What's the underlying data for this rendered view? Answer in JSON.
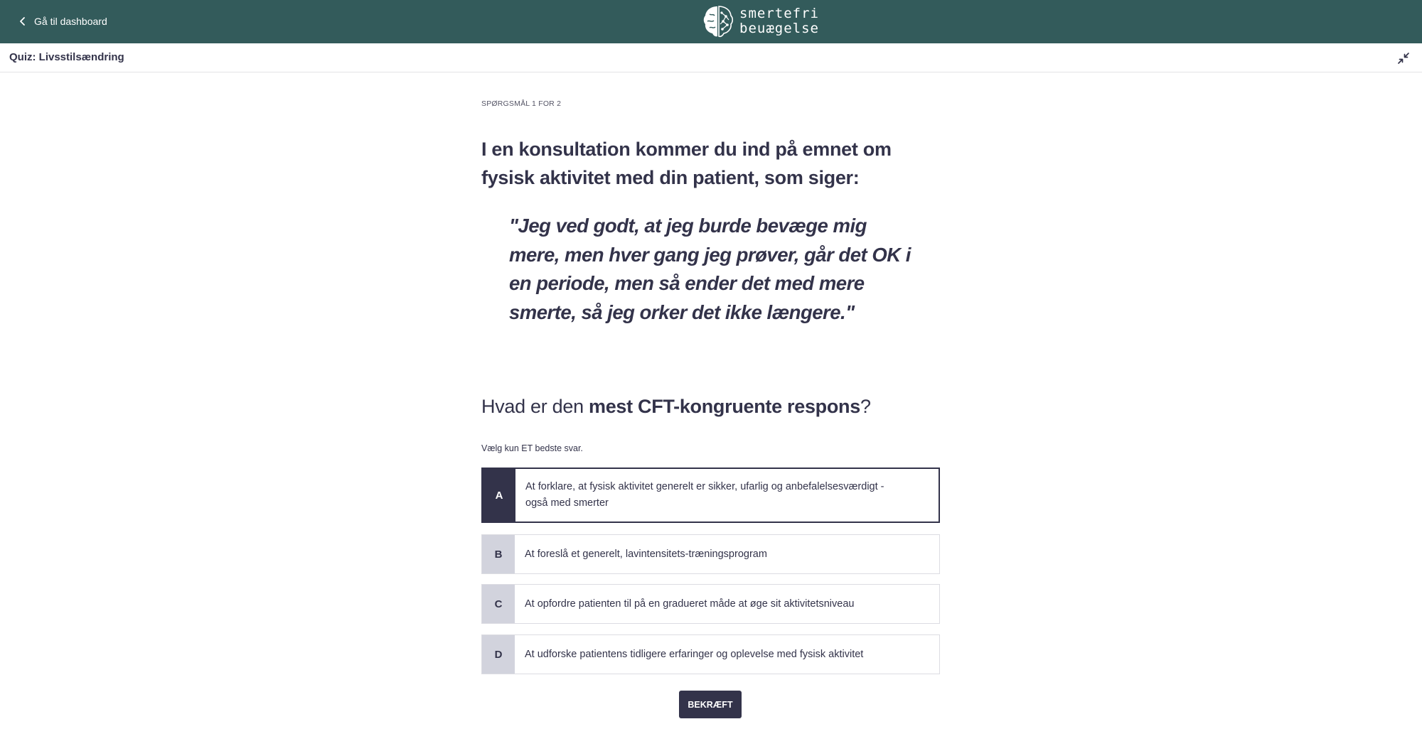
{
  "header": {
    "back_label": "Gå til dashboard",
    "logo_line1": "smertefri",
    "logo_line2": "beuægelse"
  },
  "subheader": {
    "title": "Quiz: Livsstilsændring"
  },
  "quiz": {
    "progress": "SPØRGSMÅL 1 FOR 2",
    "question": "I en konsultation kommer du ind på emnet om fysisk aktivitet med din patient, som siger:",
    "quote": "\"Jeg ved godt, at jeg burde bevæge mig mere, men hver gang jeg prøver, går det OK i en periode, men så ender det med mere smerte, så jeg orker det ikke længere.\"",
    "prompt_prefix": "Hvad er den ",
    "prompt_bold": "mest CFT-kongruente respons",
    "prompt_suffix": "?",
    "instruction": "Vælg kun ET bedste svar.",
    "options": [
      {
        "letter": "A",
        "text": "At forklare, at fysisk aktivitet generelt er sikker, ufarlig og anbefalelsesværdigt - også med smerter",
        "selected": true
      },
      {
        "letter": "B",
        "text": "At foreslå et generelt, lavintensitets-træningsprogram",
        "selected": false
      },
      {
        "letter": "C",
        "text": "At opfordre patienten til på en gradueret måde at øge sit aktivitetsniveau",
        "selected": false
      },
      {
        "letter": "D",
        "text": "At udforske patientens tidligere erfaringer og oplevelse med fysisk aktivitet",
        "selected": false
      }
    ],
    "confirm_label": "BEKRÆFT"
  },
  "colors": {
    "header_bg": "#335b5b",
    "primary": "#33334a",
    "letter_bg": "#d2d3dd"
  },
  "icons": {
    "back": "chevron-left-icon",
    "logo": "brain-icon",
    "collapse": "collapse-arrows-icon"
  }
}
